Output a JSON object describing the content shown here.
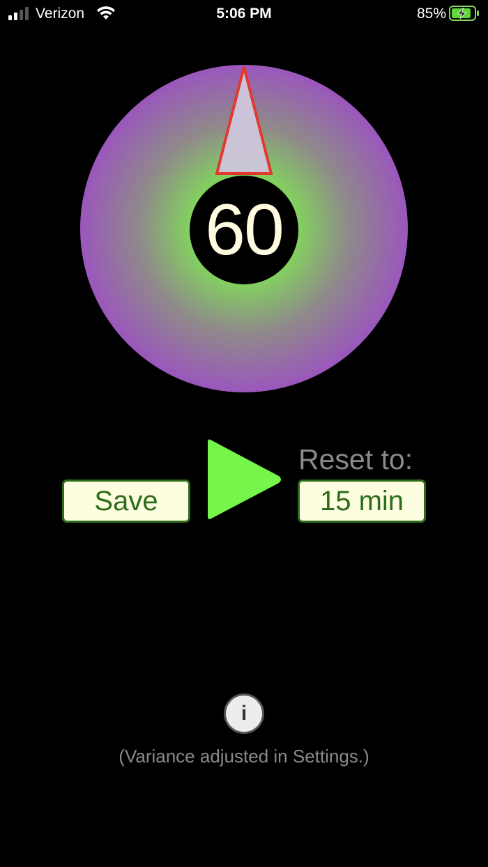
{
  "status_bar": {
    "carrier": "Verizon",
    "time": "5:06 PM",
    "battery_percent": "85%",
    "battery_level": 0.85,
    "icons": [
      "signal-icon",
      "wifi-icon",
      "battery-charging-icon"
    ]
  },
  "dial": {
    "value": "60",
    "gradient_colors": {
      "center": "#7dff4a",
      "edge": "#9c45c8"
    },
    "pointer_color": "#e03a2f"
  },
  "controls": {
    "save_label": "Save",
    "play_icon": "play-icon",
    "play_color": "#76f54a",
    "reset_label": "Reset to:",
    "reset_value": "15 min"
  },
  "info": {
    "icon_label": "i",
    "note": "(Variance adjusted in Settings.)"
  }
}
